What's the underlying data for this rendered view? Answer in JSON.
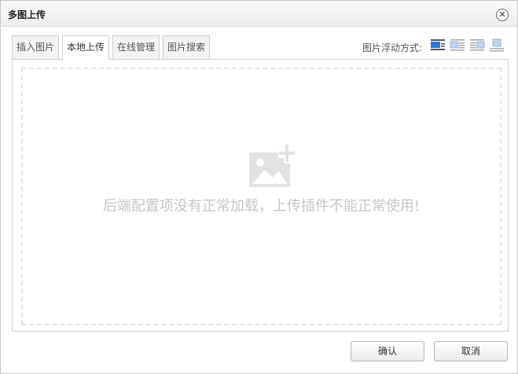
{
  "dialog": {
    "title": "多图上传"
  },
  "tabs": [
    {
      "label": "插入图片",
      "active": false
    },
    {
      "label": "本地上传",
      "active": true
    },
    {
      "label": "在线管理",
      "active": false
    },
    {
      "label": "图片搜索",
      "active": false
    }
  ],
  "float": {
    "label": "图片浮动方式:",
    "options": [
      "none-icon",
      "left-icon",
      "right-icon",
      "center-icon"
    ],
    "selected": "none-icon"
  },
  "upload": {
    "icon": "image-add-icon",
    "message": "后端配置项没有正常加载，上传插件不能正常使用!"
  },
  "buttons": {
    "ok": "确认",
    "cancel": "取消"
  },
  "colors": {
    "selected_icon": "#2b7ad8",
    "message": "#c6c6c6"
  }
}
